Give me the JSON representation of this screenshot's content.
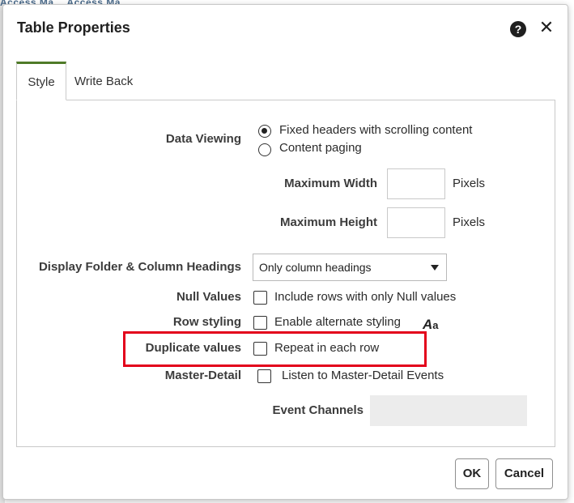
{
  "background": {
    "fragment_text": "Access Ma… Access Ma…"
  },
  "dialog": {
    "title": "Table Properties",
    "help_icon": "question-circle-icon",
    "close_icon": "close-icon",
    "tabs": [
      {
        "label": "Style",
        "active": true
      },
      {
        "label": "Write Back",
        "active": false
      }
    ],
    "data_viewing": {
      "label": "Data Viewing",
      "options": [
        {
          "label": "Fixed headers with scrolling content",
          "selected": true
        },
        {
          "label": "Content paging",
          "selected": false
        }
      ],
      "max_width": {
        "label": "Maximum Width",
        "value": "",
        "unit": "Pixels"
      },
      "max_height": {
        "label": "Maximum Height",
        "value": "",
        "unit": "Pixels"
      }
    },
    "display_headings": {
      "label": "Display Folder & Column Headings",
      "selected": "Only column headings"
    },
    "null_values": {
      "label": "Null Values",
      "checkbox_label": "Include rows with only Null values",
      "checked": false
    },
    "row_styling": {
      "label": "Row styling",
      "checkbox_label": "Enable alternate styling",
      "checked": false,
      "format_icon": "font-format-icon"
    },
    "duplicate_values": {
      "label": "Duplicate values",
      "checkbox_label": "Repeat in each row",
      "checked": false,
      "highlight_color": "#e3001b"
    },
    "master_detail": {
      "label": "Master-Detail",
      "checkbox_label": "Listen to Master-Detail Events",
      "checked": false
    },
    "event_channels": {
      "label": "Event Channels",
      "value": ""
    },
    "buttons": {
      "ok": "OK",
      "cancel": "Cancel"
    }
  },
  "colors": {
    "active_tab_accent": "#4f7a28",
    "highlight": "#e3001b"
  }
}
